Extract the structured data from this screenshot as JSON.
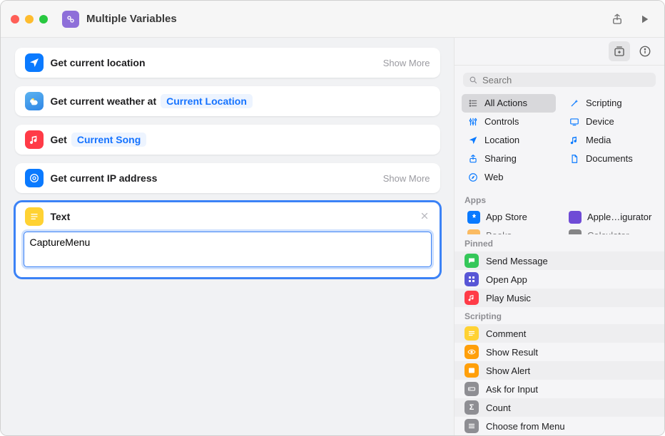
{
  "window": {
    "title": "Multiple Variables"
  },
  "actions": [
    {
      "icon": "location-arrow",
      "title_parts": [
        "Get current location"
      ],
      "show_more": "Show More"
    },
    {
      "icon": "weather",
      "title_parts": [
        "Get current weather at"
      ],
      "token": "Current Location"
    },
    {
      "icon": "music",
      "title_parts": [
        "Get"
      ],
      "token": "Current Song"
    },
    {
      "icon": "ip",
      "title_parts": [
        "Get current IP address"
      ],
      "show_more": "Show More"
    },
    {
      "icon": "text",
      "title_parts": [
        "Text"
      ],
      "body_value": "CaptureMenu",
      "selected": true
    }
  ],
  "sidebar": {
    "search_placeholder": "Search",
    "categories": [
      [
        {
          "name": "All Actions",
          "icon": "list",
          "color": "gray",
          "active": true
        },
        {
          "name": "Scripting",
          "icon": "wand",
          "color": "blue"
        }
      ],
      [
        {
          "name": "Controls",
          "icon": "equalizer",
          "color": "blue"
        },
        {
          "name": "Device",
          "icon": "display",
          "color": "blue"
        }
      ],
      [
        {
          "name": "Location",
          "icon": "nav",
          "color": "blue"
        },
        {
          "name": "Media",
          "icon": "note",
          "color": "blue"
        }
      ],
      [
        {
          "name": "Sharing",
          "icon": "share",
          "color": "blue"
        },
        {
          "name": "Documents",
          "icon": "doc",
          "color": "blue"
        }
      ],
      [
        {
          "name": "Web",
          "icon": "safari",
          "color": "blue"
        }
      ]
    ],
    "apps": [
      {
        "name": "App Store",
        "color": "#0a7aff"
      },
      {
        "name": "Apple…igurator",
        "color": "#6f4bd6"
      },
      {
        "name": "Books",
        "color": "#ff9500"
      },
      {
        "name": "Calculator",
        "color": "#3a3a3c"
      }
    ],
    "pinned_label": "Pinned",
    "pinned": [
      {
        "name": "Send Message",
        "color": "#34c759",
        "icon": "msg"
      },
      {
        "name": "Open App",
        "color": "#5856d6",
        "icon": "grid"
      },
      {
        "name": "Play Music",
        "color": "#ff3b47",
        "icon": "note"
      }
    ],
    "scripting_label": "Scripting",
    "scripting": [
      {
        "name": "Comment",
        "color": "#ffd233",
        "icon": "lines"
      },
      {
        "name": "Show Result",
        "color": "#ff9f0a",
        "icon": "eye"
      },
      {
        "name": "Show Alert",
        "color": "#ff9f0a",
        "icon": "alert"
      },
      {
        "name": "Ask for Input",
        "color": "#8e8e93",
        "icon": "input"
      },
      {
        "name": "Count",
        "color": "#8e8e93",
        "icon": "sigma"
      },
      {
        "name": "Choose from Menu",
        "color": "#8e8e93",
        "icon": "menu"
      }
    ],
    "apps_label": "Apps"
  }
}
